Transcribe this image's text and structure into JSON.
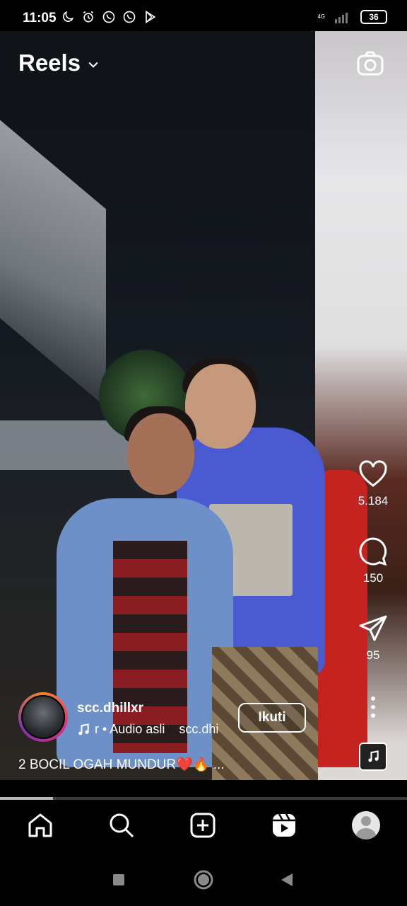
{
  "status_bar": {
    "time": "11:05",
    "network": "4G",
    "battery": "36",
    "icons": [
      "moon-icon",
      "alarm-icon",
      "whatsapp-icon",
      "whatsapp-icon",
      "play-store-icon"
    ]
  },
  "header": {
    "title": "Reels",
    "dropdown_icon": "chevron-down-icon",
    "camera_icon": "camera-icon"
  },
  "actions": {
    "likes": "5.184",
    "comments": "150",
    "shares": "95"
  },
  "post": {
    "username": "scc.dhillxr",
    "audio_prefix": "r • Audio asli",
    "audio_owner": "scc.dhi",
    "follow_label": "Ikuti",
    "caption_text": "2 BOCIL OGAH MUNDUR",
    "caption_heart": "❤️",
    "caption_fire": "🔥",
    "caption_more": " ..."
  },
  "progress": {
    "fraction": 0.13
  },
  "bottom_nav": [
    "home-icon",
    "search-icon",
    "create-icon",
    "reels-icon",
    "profile-avatar"
  ],
  "colors": {
    "accent_ring_start": "#f58529",
    "accent_ring_mid": "#dd2a7b",
    "background": "#000000"
  }
}
